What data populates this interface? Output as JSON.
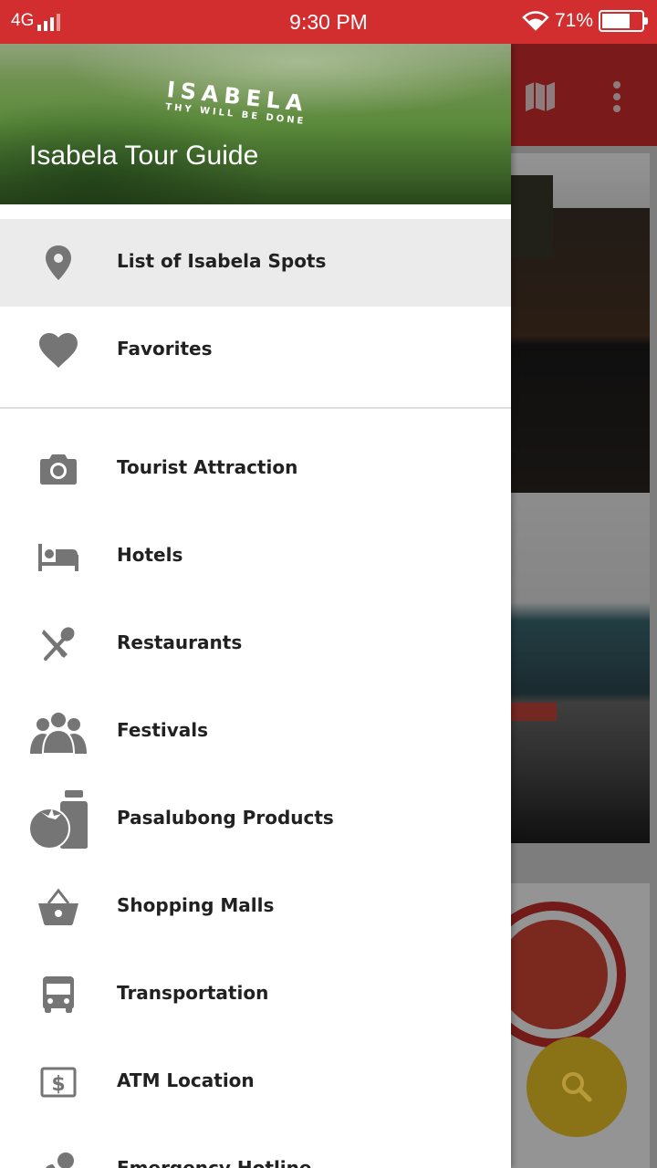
{
  "status_bar": {
    "network": "4G",
    "time": "9:30 PM",
    "battery_percent": "71%",
    "battery_level": 0.71
  },
  "toolbar": {
    "icons": [
      "map-icon",
      "more-vert-icon"
    ]
  },
  "drawer": {
    "header_sign_text": "ISABELA",
    "header_sign_subtext": "THY WILL BE DONE",
    "title": "Isabela Tour Guide",
    "primary_items": [
      {
        "label": "List of Isabela Spots",
        "icon": "location-pin-icon",
        "selected": true
      },
      {
        "label": "Favorites",
        "icon": "heart-icon",
        "selected": false
      }
    ],
    "category_items": [
      {
        "label": "Tourist Attraction",
        "icon": "camera-icon"
      },
      {
        "label": "Hotels",
        "icon": "bed-icon"
      },
      {
        "label": "Restaurants",
        "icon": "fork-spoon-icon"
      },
      {
        "label": "Festivals",
        "icon": "people-icon"
      },
      {
        "label": "Pasalubong Products",
        "icon": "tomato-bottle-icon"
      },
      {
        "label": "Shopping Malls",
        "icon": "basket-icon"
      },
      {
        "label": "Transportation",
        "icon": "bus-icon"
      },
      {
        "label": "ATM Location",
        "icon": "dollar-card-icon"
      },
      {
        "label": "Emergency Hotline",
        "icon": "phone-icon"
      }
    ]
  },
  "fab": {
    "icon": "search-icon"
  },
  "colors": {
    "primary": "#d22d2f",
    "selected_row": "#ebebeb",
    "icon_gray": "#757575",
    "fab": "#c9a41e"
  }
}
